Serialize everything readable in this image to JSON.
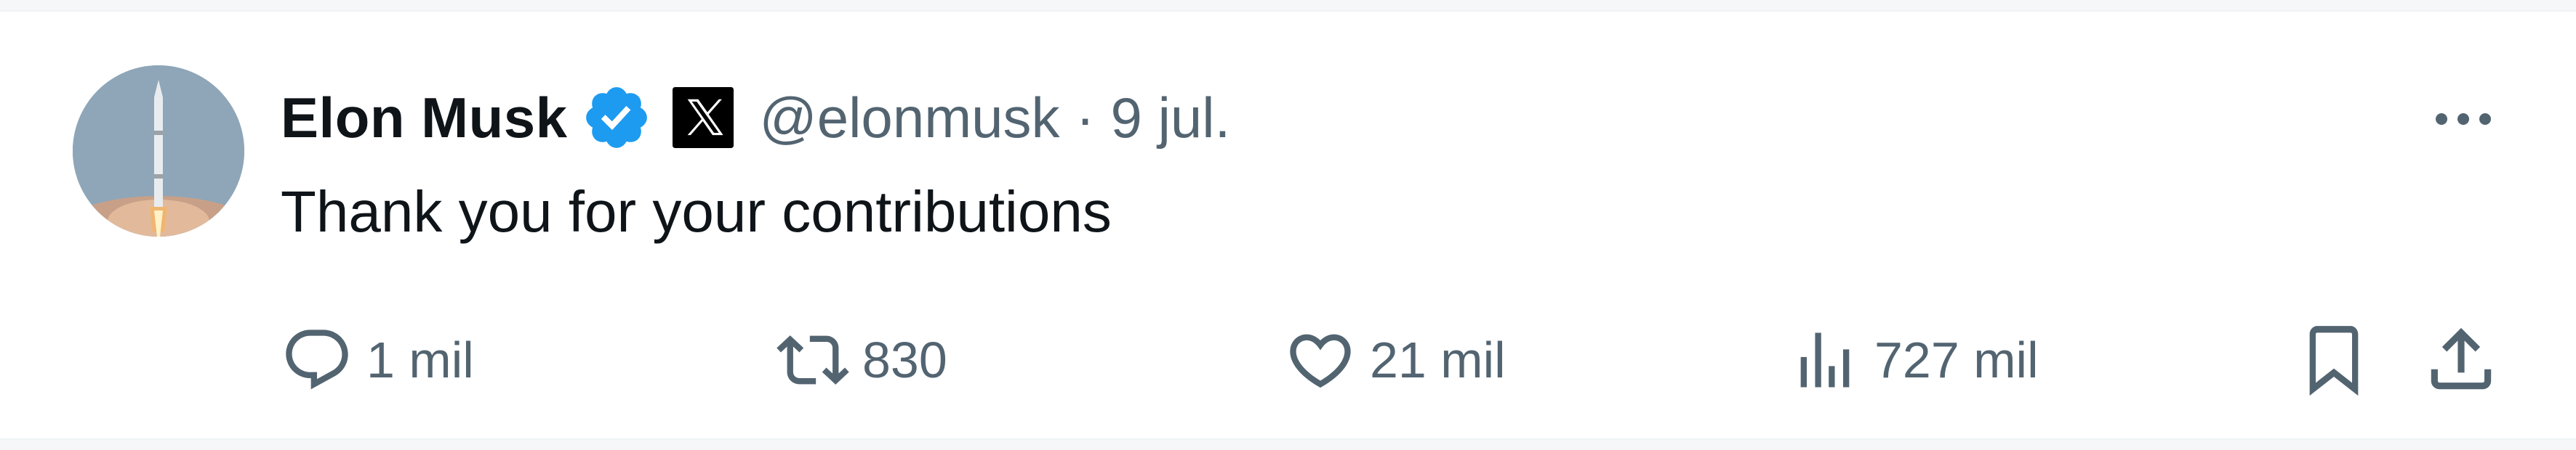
{
  "tweet": {
    "author": {
      "display_name": "Elon Musk",
      "handle": "@elonmusk",
      "verified_icon": "verified-badge-icon",
      "affiliate_icon": "x-logo-icon",
      "avatar_icon": "avatar-rocket-launch"
    },
    "separator": "·",
    "date": "9 jul.",
    "text": "Thank you for your contributions",
    "actions": {
      "replies": "1 mil",
      "retweets": "830",
      "likes": "21 mil",
      "views": "727 mil"
    },
    "colors": {
      "text_primary": "#0f1419",
      "text_secondary": "#536471",
      "verified_blue": "#1d9bf0"
    }
  }
}
